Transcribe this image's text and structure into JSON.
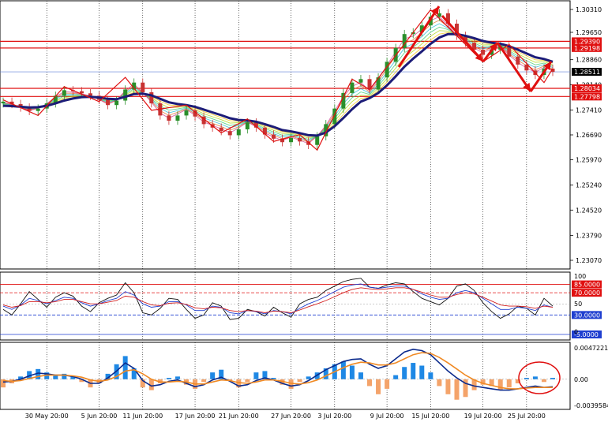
{
  "colors": {
    "background": "#ffffff",
    "bull_candle": "#2a8f2a",
    "bear_candle": "#c83232",
    "zigzag": "#e01010",
    "ma_slow": "#1c1c78",
    "resistance": "#e01010",
    "current_price_line": "#5a7bd6",
    "rsi_black": "#111111",
    "rsi_blue": "#1f3fd0",
    "rsi_red": "#d21f1f",
    "macd_hist_pos": "#1e88e5",
    "macd_hist_neg": "#f4a36a",
    "macd_line": "#0b2a8c",
    "signal_line": "#f08a24",
    "highlight_circle": "#e01010",
    "tag_red": "#e01010",
    "tag_blue": "#1f3fd0",
    "tag_black": "#000000"
  },
  "chart_data": [
    {
      "type": "line",
      "panel": "price",
      "y_ticks": [
        "1.30310",
        "1.29650",
        "1.28860",
        "1.28140",
        "1.27410",
        "1.26690",
        "1.25970",
        "1.25240",
        "1.24520",
        "1.23790",
        "1.23070"
      ],
      "ylim": [
        1.2307,
        1.3031
      ],
      "price_tags": [
        {
          "value": 1.2939,
          "label": "1.29390",
          "color": "red"
        },
        {
          "value": 1.29198,
          "label": "1.29198",
          "color": "red"
        },
        {
          "value": 1.28511,
          "label": "1.28511",
          "color": "black"
        },
        {
          "value": 1.28034,
          "label": "1.28034",
          "color": "red"
        },
        {
          "value": 1.27798,
          "label": "1.27798",
          "color": "red"
        }
      ],
      "horizontal_levels": [
        1.2939,
        1.29198,
        1.28034,
        1.27798
      ],
      "current_price": 1.28511,
      "x_dates": [
        "30 May 20:00",
        "5 Jun 20:00",
        "11 Jun 20:00",
        "17 Jun 20:00",
        "21 Jun 20:00",
        "27 Jun 20:00",
        "3 Jul 20:00",
        "9 Jul 20:00",
        "15 Jul 20:00",
        "19 Jul 20:00",
        "25 Jul 20:00"
      ],
      "series": [
        {
          "values": [
            1.2765,
            1.2758,
            1.2748,
            1.2738,
            1.2745,
            1.276,
            1.2782,
            1.2798,
            1.2795,
            1.2789,
            1.2782,
            1.277,
            1.2755,
            1.2768,
            1.28,
            1.282,
            1.2792,
            1.276,
            1.2725,
            1.271,
            1.2725,
            1.274,
            1.2722,
            1.27,
            1.269,
            1.268,
            1.2668,
            1.2685,
            1.2705,
            1.269,
            1.267,
            1.2658,
            1.2648,
            1.266,
            1.265,
            1.264,
            1.2665,
            1.27,
            1.2745,
            1.279,
            1.282,
            1.283,
            1.28,
            1.2835,
            1.288,
            1.292,
            1.296,
            1.2965,
            1.2985,
            1.301,
            1.302,
            1.299,
            1.2955,
            1.2935,
            1.2915,
            1.29,
            1.2915,
            1.2925,
            1.2895,
            1.2872,
            1.2855,
            1.2842,
            1.286,
            1.2851
          ]
        },
        {
          "values": [
            1.2753,
            1.2752,
            1.275,
            1.2748,
            1.2749,
            1.2753,
            1.276,
            1.2768,
            1.2774,
            1.2778,
            1.2779,
            1.2777,
            1.2773,
            1.2772,
            1.2779,
            1.2787,
            1.2788,
            1.2783,
            1.2773,
            1.2763,
            1.2758,
            1.2755,
            1.275,
            1.2742,
            1.2734,
            1.2726,
            1.2717,
            1.2712,
            1.2711,
            1.2707,
            1.27,
            1.2692,
            1.2683,
            1.2679,
            1.2674,
            1.2668,
            1.2667,
            1.2676,
            1.2694,
            1.2718,
            1.2743,
            1.2765,
            1.2775,
            1.279,
            1.2812,
            1.2838,
            1.2866,
            1.2889,
            1.291,
            1.2932,
            1.295,
            1.296,
            1.296,
            1.2955,
            1.2948,
            1.294,
            1.2935,
            1.2932,
            1.2925,
            1.2915,
            1.2904,
            1.2893,
            1.2888,
            1.288
          ]
        }
      ],
      "zigzag": [
        [
          0,
          1.277
        ],
        [
          4,
          1.2725
        ],
        [
          7,
          1.2808
        ],
        [
          11,
          1.2765
        ],
        [
          14,
          1.2835
        ],
        [
          17,
          1.274
        ],
        [
          21,
          1.2755
        ],
        [
          25,
          1.2675
        ],
        [
          28,
          1.2715
        ],
        [
          31,
          1.265
        ],
        [
          34,
          1.267
        ],
        [
          36,
          1.2625
        ],
        [
          40,
          1.283
        ],
        [
          42,
          1.28
        ],
        [
          49,
          1.303
        ],
        [
          55,
          1.288
        ],
        [
          58,
          1.293
        ],
        [
          62,
          1.282
        ],
        [
          63,
          1.286
        ]
      ]
    },
    {
      "type": "line",
      "panel": "oscillator",
      "ylim": [
        -5,
        100
      ],
      "y_ticks": [
        "100",
        "50",
        "0"
      ],
      "levels": [
        {
          "value": 85,
          "label": "85.0000",
          "color": "red"
        },
        {
          "value": 70,
          "label": "70.0000",
          "color": "red"
        },
        {
          "value": 30,
          "label": "30.0000",
          "color": "blue"
        },
        {
          "value": -5,
          "label": "-5.0000",
          "color": "blue"
        }
      ],
      "series": [
        {
          "values": [
            40,
            30,
            50,
            72,
            58,
            44,
            62,
            70,
            64,
            46,
            36,
            52,
            60,
            66,
            88,
            70,
            34,
            30,
            42,
            60,
            58,
            40,
            24,
            30,
            52,
            46,
            22,
            24,
            40,
            36,
            28,
            44,
            34,
            26,
            50,
            58,
            62,
            74,
            82,
            90,
            94,
            96,
            80,
            78,
            84,
            88,
            86,
            72,
            60,
            54,
            48,
            60,
            82,
            86,
            74,
            52,
            36,
            24,
            32,
            46,
            42,
            30,
            60,
            46
          ]
        },
        {
          "values": [
            46,
            40,
            48,
            60,
            56,
            50,
            56,
            62,
            60,
            52,
            46,
            50,
            56,
            60,
            72,
            66,
            50,
            44,
            46,
            54,
            54,
            48,
            38,
            38,
            46,
            44,
            34,
            32,
            38,
            36,
            32,
            38,
            36,
            32,
            42,
            50,
            56,
            64,
            72,
            80,
            84,
            86,
            80,
            78,
            80,
            82,
            82,
            76,
            68,
            62,
            58,
            60,
            70,
            74,
            70,
            60,
            50,
            40,
            40,
            44,
            42,
            38,
            48,
            44
          ]
        },
        {
          "values": [
            48,
            44,
            47,
            54,
            54,
            52,
            54,
            58,
            58,
            54,
            50,
            50,
            53,
            56,
            64,
            62,
            54,
            48,
            47,
            51,
            52,
            49,
            43,
            41,
            44,
            43,
            38,
            36,
            38,
            37,
            34,
            37,
            36,
            34,
            39,
            45,
            50,
            56,
            63,
            70,
            76,
            79,
            77,
            76,
            77,
            79,
            79,
            76,
            71,
            66,
            62,
            62,
            67,
            70,
            68,
            62,
            55,
            48,
            46,
            46,
            45,
            42,
            46,
            44
          ]
        }
      ]
    },
    {
      "type": "bar",
      "panel": "macd",
      "ylim": [
        -0.003958,
        0.004722
      ],
      "y_ticks": [
        "0.0047221",
        "0.00",
        "-0.0039584"
      ],
      "histogram": [
        -0.0012,
        -0.0006,
        0.0004,
        0.0012,
        0.0015,
        0.001,
        0.0006,
        0.0008,
        0.0004,
        -0.0004,
        -0.0012,
        -0.0006,
        0.0008,
        0.0022,
        0.0034,
        0.0016,
        -0.0012,
        -0.0016,
        -0.0006,
        0.0002,
        0.0004,
        -0.0008,
        -0.0014,
        -0.0004,
        0.001,
        0.0014,
        -0.0002,
        -0.0012,
        -0.0004,
        0.001,
        0.0012,
        0.0002,
        -0.0008,
        -0.0014,
        -0.0004,
        0.0004,
        0.001,
        0.0016,
        0.0022,
        0.0026,
        0.002,
        0.001,
        -0.001,
        -0.0022,
        -0.0014,
        0.0006,
        0.0018,
        0.0024,
        0.002,
        0.001,
        -0.001,
        -0.0022,
        -0.003,
        -0.0026,
        -0.0016,
        -0.0008,
        -0.001,
        -0.0016,
        -0.0012,
        -0.0006,
        0.0002,
        0.0004,
        -0.0004,
        0.0002
      ],
      "series": [
        {
          "values": [
            -0.0004,
            -0.0003,
            0.0,
            0.0005,
            0.0009,
            0.0008,
            0.0006,
            0.0006,
            0.0004,
            0.0,
            -0.0006,
            -0.0006,
            0.0002,
            0.0012,
            0.0024,
            0.0016,
            -0.0002,
            -0.001,
            -0.0008,
            -0.0003,
            -0.0001,
            -0.0006,
            -0.0011,
            -0.0008,
            -0.0001,
            0.0003,
            -0.0003,
            -0.001,
            -0.0008,
            -0.0002,
            0.0002,
            -0.0001,
            -0.0006,
            -0.001,
            -0.0008,
            -0.0002,
            0.0006,
            0.0014,
            0.002,
            0.0026,
            0.0029,
            0.003,
            0.0022,
            0.0016,
            0.002,
            0.003,
            0.004,
            0.0044,
            0.0042,
            0.0036,
            0.0024,
            0.0012,
            0.0002,
            -0.0006,
            -0.001,
            -0.0012,
            -0.0014,
            -0.0016,
            -0.0016,
            -0.0014,
            -0.0012,
            -0.001,
            -0.0012,
            -0.0011
          ]
        },
        {
          "values": [
            -0.0002,
            -0.0003,
            -0.0002,
            0.0001,
            0.0004,
            0.0006,
            0.0006,
            0.0006,
            0.0005,
            0.0003,
            -0.0001,
            -0.0003,
            -0.0001,
            0.0004,
            0.0012,
            0.0014,
            0.0008,
            0.0,
            -0.0004,
            -0.0004,
            -0.0003,
            -0.0004,
            -0.0007,
            -0.0007,
            -0.0004,
            -0.0001,
            -0.0002,
            -0.0005,
            -0.0006,
            -0.0004,
            -0.0001,
            -0.0001,
            -0.0003,
            -0.0006,
            -0.0007,
            -0.0005,
            -0.0001,
            0.0005,
            0.0011,
            0.0017,
            0.0022,
            0.0025,
            0.0024,
            0.0021,
            0.0021,
            0.0024,
            0.003,
            0.0036,
            0.0039,
            0.0038,
            0.0032,
            0.0024,
            0.0015,
            0.0006,
            -0.0001,
            -0.0006,
            -0.0009,
            -0.0012,
            -0.0014,
            -0.0014,
            -0.0013,
            -0.0012,
            -0.0012,
            -0.0012
          ]
        }
      ]
    }
  ]
}
